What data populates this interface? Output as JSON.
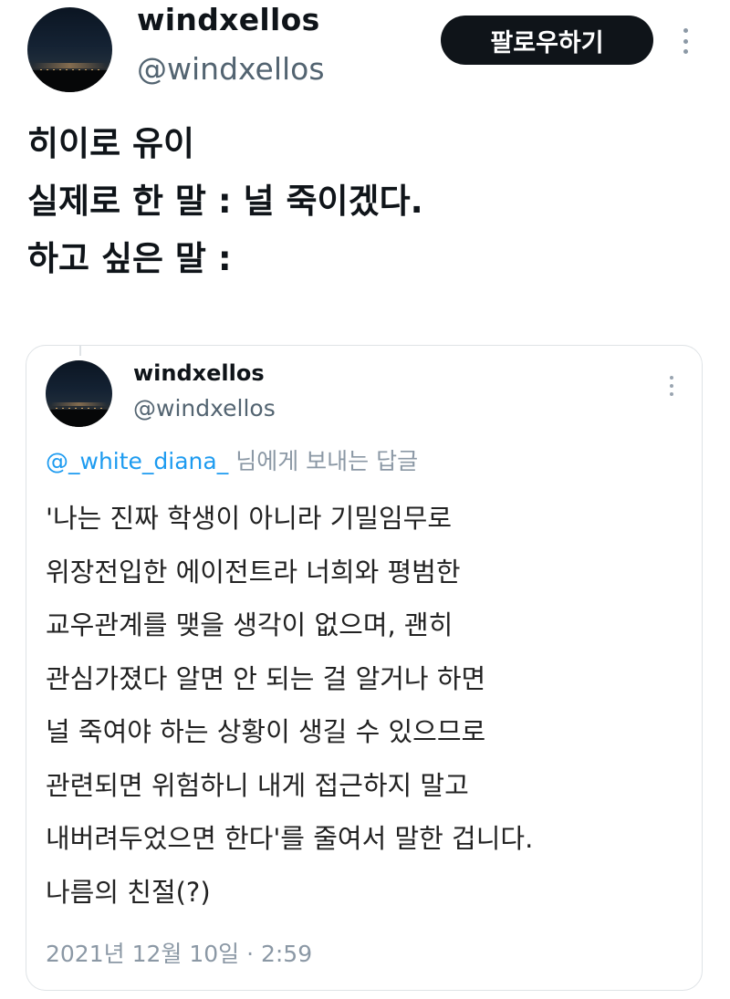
{
  "tweet": {
    "author": {
      "display_name": "windxellos",
      "handle": "@windxellos"
    },
    "follow_button_label": "팔로우하기",
    "more_icon": "more-vertical-icon",
    "text_lines": [
      "히이로 유이",
      "실제로 한 말 : 널 죽이겠다.",
      "하고 싶은 말 :"
    ]
  },
  "quoted_tweet": {
    "author": {
      "display_name": "windxellos",
      "handle": "@windxellos"
    },
    "more_icon": "more-vertical-icon",
    "reply_to": {
      "mention": "@_white_diana_",
      "suffix": "님에게 보내는 답글"
    },
    "text_lines": [
      "'나는 진짜 학생이 아니라 기밀임무로",
      "위장전입한 에이전트라 너희와 평범한",
      "교우관계를 맺을 생각이 없으며, 괜히",
      "관심가졌다 알면 안 되는 걸 알거나 하면",
      "널 죽여야 하는 상황이 생길 수 있으므로",
      "관련되면 위험하니 내게 접근하지 말고",
      "내버려두었으면 한다'를 줄여서 말한 겁니다.",
      "나름의 친절(?)"
    ],
    "timestamp": "2021년 12월 10일 · 2:59"
  },
  "colors": {
    "text_primary": "#0f1419",
    "text_secondary": "#536471",
    "link": "#1d9bf0",
    "button_bg": "#0f1419",
    "button_text": "#ffffff",
    "border": "#dfe3e6"
  }
}
